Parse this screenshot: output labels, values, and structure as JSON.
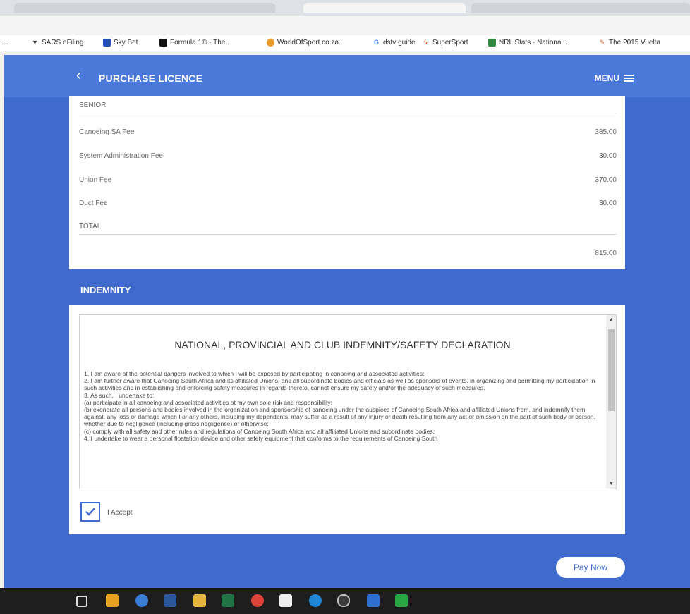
{
  "bookmarks": [
    {
      "label": "SARS eFiling",
      "icon": "triangle-down-icon"
    },
    {
      "label": "Sky Bet",
      "icon": "skybet-icon"
    },
    {
      "label": "Formula 1® - The...",
      "icon": "f1-icon"
    },
    {
      "label": "WorldOfSport.co.za...",
      "icon": "wos-icon"
    },
    {
      "label": "dstv guide",
      "icon": "google-icon"
    },
    {
      "label": "SuperSport",
      "icon": "supersport-icon"
    },
    {
      "label": "NRL Stats - Nationa...",
      "icon": "nrl-icon"
    },
    {
      "label": "The 2015 Vuelta",
      "icon": "vuelta-icon"
    }
  ],
  "header": {
    "back": "‹",
    "title": "PURCHASE LICENCE",
    "menu": "MENU"
  },
  "fees": {
    "category": "SENIOR",
    "rows": [
      {
        "label": "Canoeing SA Fee",
        "value": "385.00"
      },
      {
        "label": "System Administration Fee",
        "value": "30.00"
      },
      {
        "label": "Union Fee",
        "value": "370.00"
      },
      {
        "label": "Duct Fee",
        "value": "30.00"
      }
    ],
    "total_label": "TOTAL",
    "total_value": "815.00"
  },
  "indemnity": {
    "section_title": "INDEMNITY",
    "heading": "NATIONAL, PROVINCIAL AND CLUB INDEMNITY/SAFETY DECLARATION",
    "lines": [
      "1. I am aware of the potential dangers involved to which I will be exposed by participating in canoeing and associated activities;",
      "2. I am further aware that Canoeing South Africa and its affiliated Unions, and all subordinate bodies and officials as well as sponsors of events, in organizing and permitting my participation in such activities and in establishing and enforcing safety measures in regards thereto, cannot ensure my safety and/or the adequacy of such measures.",
      "3. As such, I undertake to:",
      "(a) participate in all canoeing and associated activities at my own sole risk and responsibility;",
      "(b) exonerate all persons and bodies involved in the organization and sponsorship of canoeing under the auspices of Canoeing South Africa and affiliated Unions from, and indemnify them against, any loss or damage which I or any others, including my dependents, may suffer as a result of any injury or death resulting from any act or omission on the part of such body or person, whether due to negligence (including gross negligence) or otherwise;",
      "(c) comply with all safety and other rules and regulations of Canoeing South Africa and all affiliated Unions and subordinate bodies;",
      "4. I undertake to wear a personal floatation device and other safety equipment that conforms to the requirements of Canoeing South"
    ],
    "accept_label": "I Accept",
    "accepted": true
  },
  "pay_button": "Pay Now",
  "colors": {
    "brand_blue": "#3e6bcd",
    "header_blue": "#4a79da"
  },
  "taskbar_icons": [
    "task-view-icon",
    "outlook-icon",
    "network-icon",
    "word-icon",
    "file-explorer-icon",
    "excel-icon",
    "chrome-icon",
    "calendar-icon",
    "edge-icon",
    "app-icon",
    "photos-icon",
    "spreadsheet-icon"
  ]
}
